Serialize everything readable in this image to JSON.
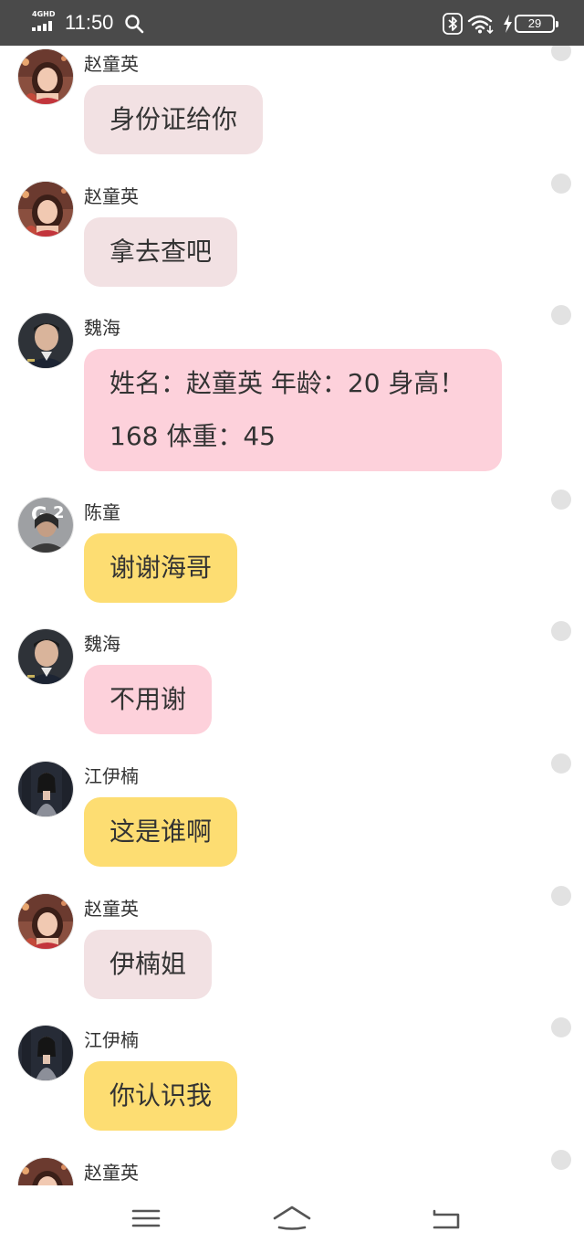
{
  "status_bar": {
    "network": "4GHD",
    "time": "11:50",
    "battery": "29"
  },
  "messages": [
    {
      "sender": "赵童英",
      "text": "身份证给你",
      "bubble_color": "#f2e1e3",
      "avatar": "avatar-zhao"
    },
    {
      "sender": "赵童英",
      "text": "拿去查吧",
      "bubble_color": "#f2e1e3",
      "avatar": "avatar-zhao"
    },
    {
      "sender": "魏海",
      "text": "姓名：赵童英 年龄：20 身高！168 体重：45",
      "bubble_color": "#fdd1db",
      "avatar": "avatar-wei"
    },
    {
      "sender": "陈童",
      "text": "谢谢海哥",
      "bubble_color": "#fddd72",
      "avatar": "avatar-chen"
    },
    {
      "sender": "魏海",
      "text": "不用谢",
      "bubble_color": "#fdd1db",
      "avatar": "avatar-wei"
    },
    {
      "sender": "江伊楠",
      "text": "这是谁啊",
      "bubble_color": "#fddd72",
      "avatar": "avatar-jiang"
    },
    {
      "sender": "赵童英",
      "text": "伊楠姐",
      "bubble_color": "#f2e1e3",
      "avatar": "avatar-zhao"
    },
    {
      "sender": "江伊楠",
      "text": "你认识我",
      "bubble_color": "#fddd72",
      "avatar": "avatar-jiang"
    },
    {
      "sender": "赵童英",
      "text": "",
      "bubble_color": "#f2e1e3",
      "avatar": "avatar-zhao"
    }
  ],
  "nav_bar": {
    "icons": [
      "menu-icon",
      "home-icon",
      "back-icon"
    ]
  }
}
